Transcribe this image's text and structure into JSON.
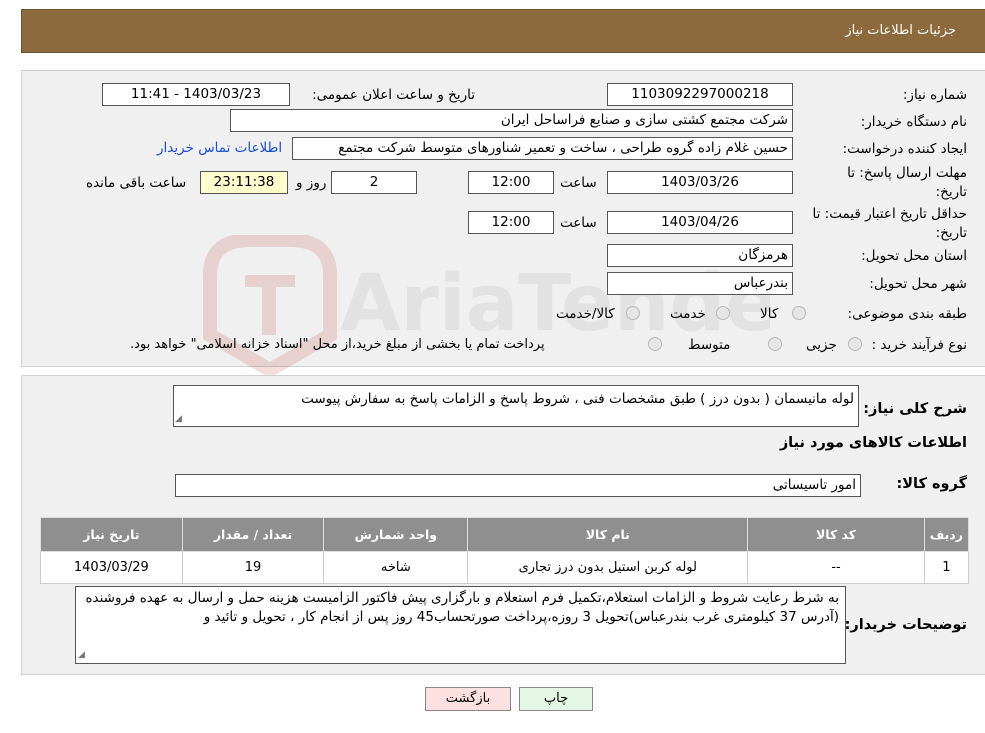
{
  "header": {
    "title": "جزئیات اطلاعات نیاز"
  },
  "form": {
    "need_number_label": "شماره نیاز:",
    "need_number": "1103092297000218",
    "announce_label": "تاریخ و ساعت اعلان عمومی:",
    "announce_value": "1403/03/23 - 11:41",
    "buyer_org_label": "نام دستگاه خریدار:",
    "buyer_org": "شرکت مجتمع کشتی سازی و صنایع فراساحل ایران",
    "creator_label": "ایجاد کننده درخواست:",
    "creator": "حسین  غلام زاده گروه طراحی ، ساخت و تعمیر شناورهای متوسط شرکت مجتمع",
    "contact_link": "اطلاعات تماس خریدار",
    "reply_deadline_label_1": "مهلت ارسال پاسخ: تا",
    "reply_deadline_label_2": "تاریخ:",
    "reply_date": "1403/03/26",
    "time_label": "ساعت",
    "reply_time": "12:00",
    "days_value": "2",
    "days_label": "روز و",
    "remaining_time": "23:11:38",
    "remaining_label": "ساعت باقی مانده",
    "price_validity_label_1": "حداقل تاریخ اعتبار قیمت: تا",
    "price_validity_label_2": "تاریخ:",
    "validity_date": "1403/04/26",
    "validity_time": "12:00",
    "province_label": "استان محل تحویل:",
    "province": "هرمزگان",
    "city_label": "شهر محل تحویل:",
    "city": "بندرعباس",
    "category_label": "طبقه بندی موضوعی:",
    "category_options": [
      "کالا",
      "خدمت",
      "کالا/خدمت"
    ],
    "process_label": "نوع فرآیند خرید :",
    "process_options": [
      "جزیی",
      "متوسط"
    ],
    "process_note": "پرداخت تمام یا بخشی از مبلغ خرید،از محل \"اسناد خزانه اسلامی\" خواهد بود."
  },
  "description": {
    "label": "شرح کلی نیاز:",
    "value": "لوله مانیسمان ( بدون درز )  طبق مشخصات فنی ، شروط پاسخ و الزامات پاسخ به سفارش پیوست"
  },
  "goods_section": {
    "title": "اطلاعات کالاهای مورد نیاز",
    "group_label": "گروه کالا:",
    "group_value": "امور تاسیساتی"
  },
  "table": {
    "headers": [
      "ردیف",
      "کد کالا",
      "نام کالا",
      "واحد شمارش",
      "تعداد / مقدار",
      "تاریخ نیاز"
    ],
    "rows": [
      [
        "1",
        "--",
        "لوله کربن استیل بدون درز تجاری",
        "شاخه",
        "19",
        "1403/03/29"
      ]
    ]
  },
  "buyer_notes": {
    "label": "توضیحات خریدار:",
    "value": "به شرط رعایت شروط و الزامات استعلام،تکمیل فرم استعلام و بارگزاری پیش فاکتور  الزامیست هزینه حمل و ارسال  به عهده فروشنده (آدرس 37 کیلومتری غرب بندرعباس)تحویل 3 روزه،پرداخت صورتحساب45 روز پس از انجام کار ،  تحویل و تائید و"
  },
  "buttons": {
    "print": "چاپ",
    "back": "بازگشت"
  },
  "colors": {
    "header_bg": "#8c6a3e",
    "table_header_bg": "#8f8f8f",
    "back_button_bg": "#fde0e0",
    "print_button_bg": "#e4f7e4",
    "link": "#1a4fd0"
  }
}
